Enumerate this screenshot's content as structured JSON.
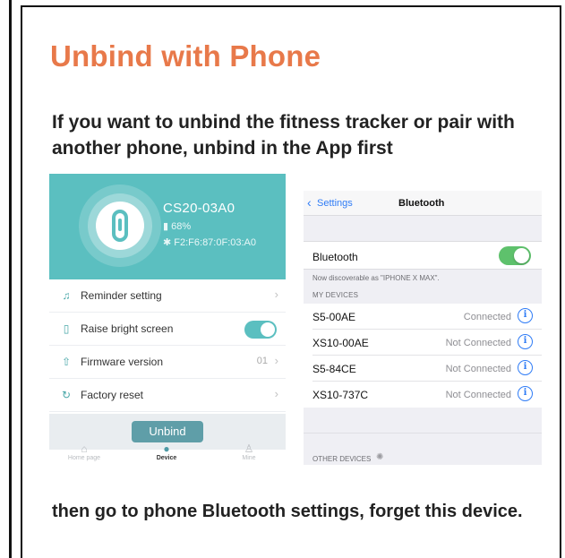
{
  "title": "Unbind with Phone",
  "subtitle": "If you want to unbind the fitness tracker or pair with another phone, unbind in the App first",
  "footer": "then go to phone Bluetooth settings, forget this device.",
  "colors": {
    "title": "#e8794a",
    "app_teal": "#5bbfc0",
    "ios_blue": "#2f7cf6",
    "ios_green": "#5ec16c"
  },
  "app": {
    "device_name": "CS20-03A0",
    "battery": "68%",
    "battery_icon": "battery-icon",
    "mac": "F2:F6:87:0F:03:A0",
    "bluetooth_icon": "bluetooth-icon",
    "menu": [
      {
        "icon": "bell-icon",
        "glyph": "🔔",
        "label": "Reminder setting",
        "right": ""
      },
      {
        "icon": "bright-screen-icon",
        "glyph": "◉",
        "label": "Raise bright screen",
        "right": ""
      },
      {
        "icon": "firmware-upload-icon",
        "glyph": "⇧",
        "label": "Firmware version",
        "right": "01"
      },
      {
        "icon": "reset-icon",
        "glyph": "↻",
        "label": "Factory reset",
        "right": ""
      }
    ],
    "raise_bright_screen_on": true,
    "unbind_label": "Unbind",
    "tabs": [
      {
        "label": "Home page",
        "icon": "home-icon"
      },
      {
        "label": "Device",
        "icon": "device-icon"
      },
      {
        "label": "Mine",
        "icon": "person-icon"
      }
    ]
  },
  "ios": {
    "back_label": "Settings",
    "nav_title": "Bluetooth",
    "bluetooth_label": "Bluetooth",
    "bluetooth_on": true,
    "discoverable": "Now discoverable as \"IPHONE X MAX\".",
    "my_devices_header": "MY DEVICES",
    "devices": [
      {
        "name": "S5-00AE",
        "status": "Connected"
      },
      {
        "name": "XS10-00AE",
        "status": "Not Connected"
      },
      {
        "name": "S5-84CE",
        "status": "Not Connected"
      },
      {
        "name": "XS10-737C",
        "status": "Not Connected"
      }
    ],
    "other_devices_header": "OTHER DEVICES"
  }
}
